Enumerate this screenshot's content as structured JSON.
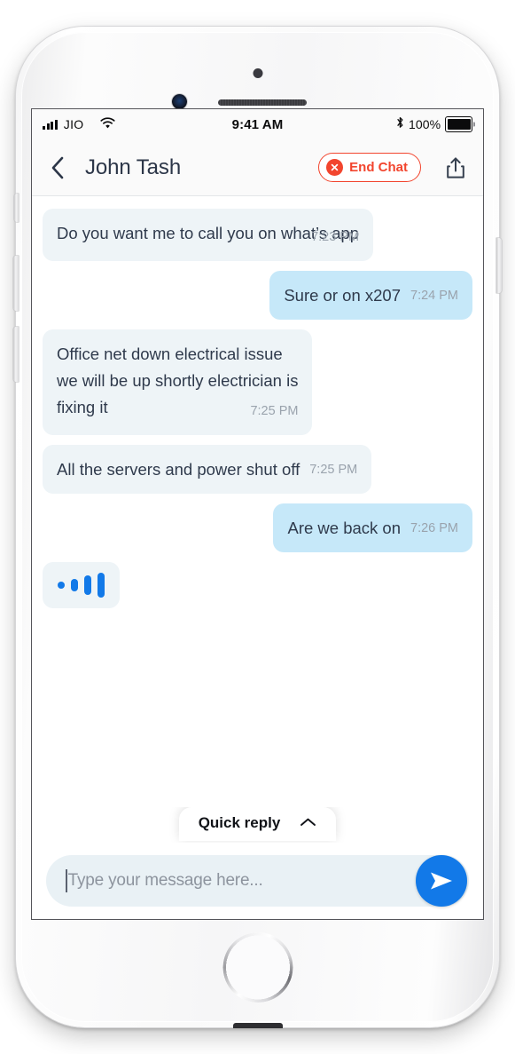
{
  "status_bar": {
    "signal_icon": "signal-bars-icon",
    "carrier": "JIO",
    "wifi_icon": "wifi-icon",
    "time": "9:41 AM",
    "bluetooth_icon": "bluetooth-icon",
    "battery_percent": "100%",
    "battery_icon": "battery-full-icon"
  },
  "header": {
    "back_icon": "chevron-left-icon",
    "title": "John Tash",
    "end_chat": {
      "label": "End Chat",
      "icon": "close-circle-icon",
      "color": "#f2452e"
    },
    "share_icon": "share-icon"
  },
  "conversation": {
    "messages": [
      {
        "id": "msg-1",
        "direction": "incoming",
        "text": "Do you want me to call you on what’s app",
        "time": "7:23 PM",
        "layout": "block"
      },
      {
        "id": "msg-2",
        "direction": "outgoing",
        "text": "Sure or on x207",
        "time": "7:24 PM",
        "layout": "inline"
      },
      {
        "id": "msg-3",
        "direction": "incoming",
        "text": "Office net down electrical issue\nwe will be up shortly electrician is\nfixing it",
        "time": "7:25 PM",
        "layout": "block"
      },
      {
        "id": "msg-4",
        "direction": "incoming",
        "text": "All the servers and power shut off",
        "time": "7:25 PM",
        "layout": "inline"
      },
      {
        "id": "msg-5",
        "direction": "outgoing",
        "text": "Are we back on",
        "time": "7:26 PM",
        "layout": "inline"
      }
    ],
    "typing_indicator": {
      "visible": true,
      "icon": "typing-bars-icon",
      "color": "#1279e8"
    }
  },
  "quick_reply": {
    "label": "Quick reply",
    "chevron_icon": "chevron-up-icon"
  },
  "composer": {
    "placeholder": "Type your message here...",
    "value": "",
    "send_icon": "send-icon",
    "send_color": "#1279e8"
  },
  "device": {
    "camera_icon": "front-camera-icon",
    "sensor_icon": "proximity-sensor-icon",
    "speaker_icon": "earpiece-speaker-icon",
    "home_button_icon": "home-button-icon"
  },
  "colors": {
    "incoming_bubble": "#eef4f7",
    "outgoing_bubble": "#c6e8f9",
    "text": "#2f3a4c",
    "timestamp": "#9aa3ad",
    "accent_blue": "#1279e8",
    "accent_red": "#f2452e"
  }
}
